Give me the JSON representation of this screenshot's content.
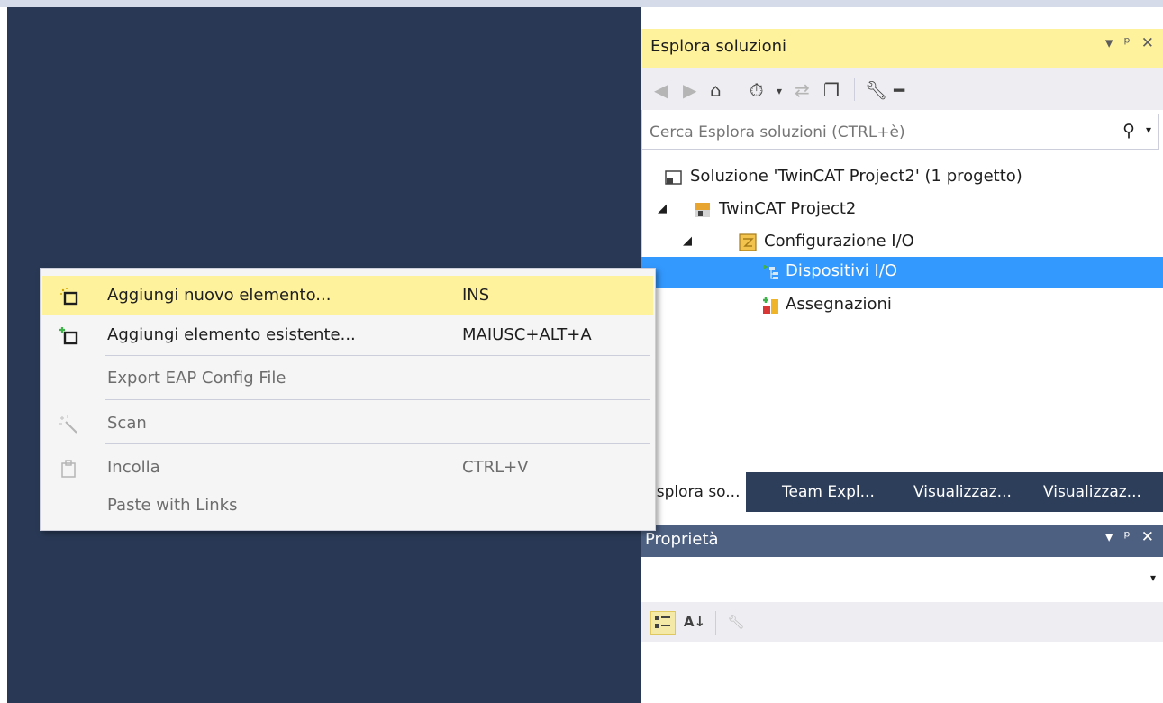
{
  "solution_explorer": {
    "title": "Esplora soluzioni",
    "title_buttons": [
      "▾",
      "ᵖ",
      "✕"
    ],
    "search_placeholder": "Cerca Esplora soluzioni (CTRL+è)",
    "tree": {
      "solution": "Soluzione 'TwinCAT Project2'  (1 progetto)",
      "project": "TwinCAT Project2",
      "io_config": "Configurazione I/O",
      "io_devices": "Dispositivi I/O",
      "mappings": "Assegnazioni"
    },
    "tabs": [
      "Esplora so...",
      "Team Expl...",
      "Visualizzaz...",
      "Visualizzaz..."
    ]
  },
  "properties": {
    "title": "Proprietà",
    "title_buttons": [
      "▾",
      "ᵖ",
      "✕"
    ]
  },
  "context_menu": {
    "items": [
      {
        "label": "Aggiungi nuovo elemento...",
        "shortcut": "INS",
        "enabled": true,
        "highlighted": true,
        "icon": "new-item-icon"
      },
      {
        "label": "Aggiungi elemento esistente...",
        "shortcut": "MAIUSC+ALT+A",
        "enabled": true,
        "icon": "existing-item-icon"
      },
      {
        "label": "Export EAP Config File",
        "shortcut": "",
        "enabled": false
      },
      {
        "label": "Scan",
        "shortcut": "",
        "enabled": false,
        "icon": "scan-wand-icon"
      },
      {
        "label": "Incolla",
        "shortcut": "CTRL+V",
        "enabled": false,
        "icon": "paste-icon"
      },
      {
        "label": "Paste with Links",
        "shortcut": "",
        "enabled": false
      }
    ]
  },
  "colors": {
    "editor_bg": "#293955",
    "highlight": "#fff29d",
    "selection": "#3399ff"
  }
}
